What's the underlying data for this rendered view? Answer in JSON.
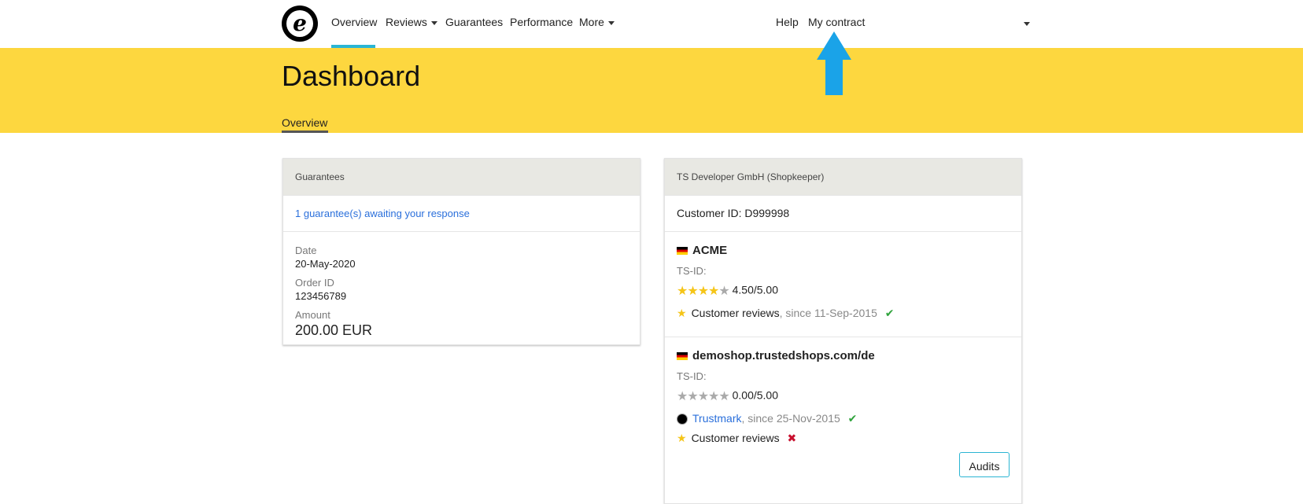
{
  "nav": {
    "logo_letter": "e",
    "items": [
      {
        "label": "Overview"
      },
      {
        "label": "Reviews"
      },
      {
        "label": "Guarantees"
      },
      {
        "label": "Performance"
      },
      {
        "label": "More"
      }
    ],
    "help_label": "Help",
    "contract_label": "My contract"
  },
  "banner": {
    "title": "Dashboard",
    "subtab_label": "Overview"
  },
  "colors": {
    "banner": "#fdd73f",
    "accent": "#2bb5d3",
    "arrow": "#1aa3e8",
    "link": "#2a6fdb"
  },
  "guarantees_card": {
    "header": "Guarantees",
    "awaiting_link": "1 guarantee(s) awaiting your response",
    "date_label": "Date",
    "date_value": "20-May-2020",
    "order_label": "Order ID",
    "order_value": "123456789",
    "amount_label": "Amount",
    "amount_value": "200.00 EUR"
  },
  "account_card": {
    "header": "TS Developer GmbH (Shopkeeper)",
    "customer_id": "Customer ID: D999998",
    "shops": [
      {
        "name": "ACME",
        "tsid_label": "TS-ID:",
        "rating": "4.50/5.00",
        "rating_stars": 4.5,
        "features": [
          {
            "icon": "star-icon",
            "name": "Customer reviews",
            "since": ", since 11-Sep-2015",
            "status": "check-icon"
          }
        ]
      },
      {
        "name": "demoshop.trustedshops.com/de",
        "tsid_label": "TS-ID:",
        "rating": "0.00/5.00",
        "rating_stars": 0,
        "features": [
          {
            "icon": "trustmark-icon",
            "name": "Trustmark",
            "since": ", since 25-Nov-2015",
            "status": "check-icon"
          },
          {
            "icon": "star-icon",
            "name": "Customer reviews",
            "since": "",
            "status": "cross-icon"
          }
        ],
        "audits_label": "Audits"
      }
    ]
  }
}
